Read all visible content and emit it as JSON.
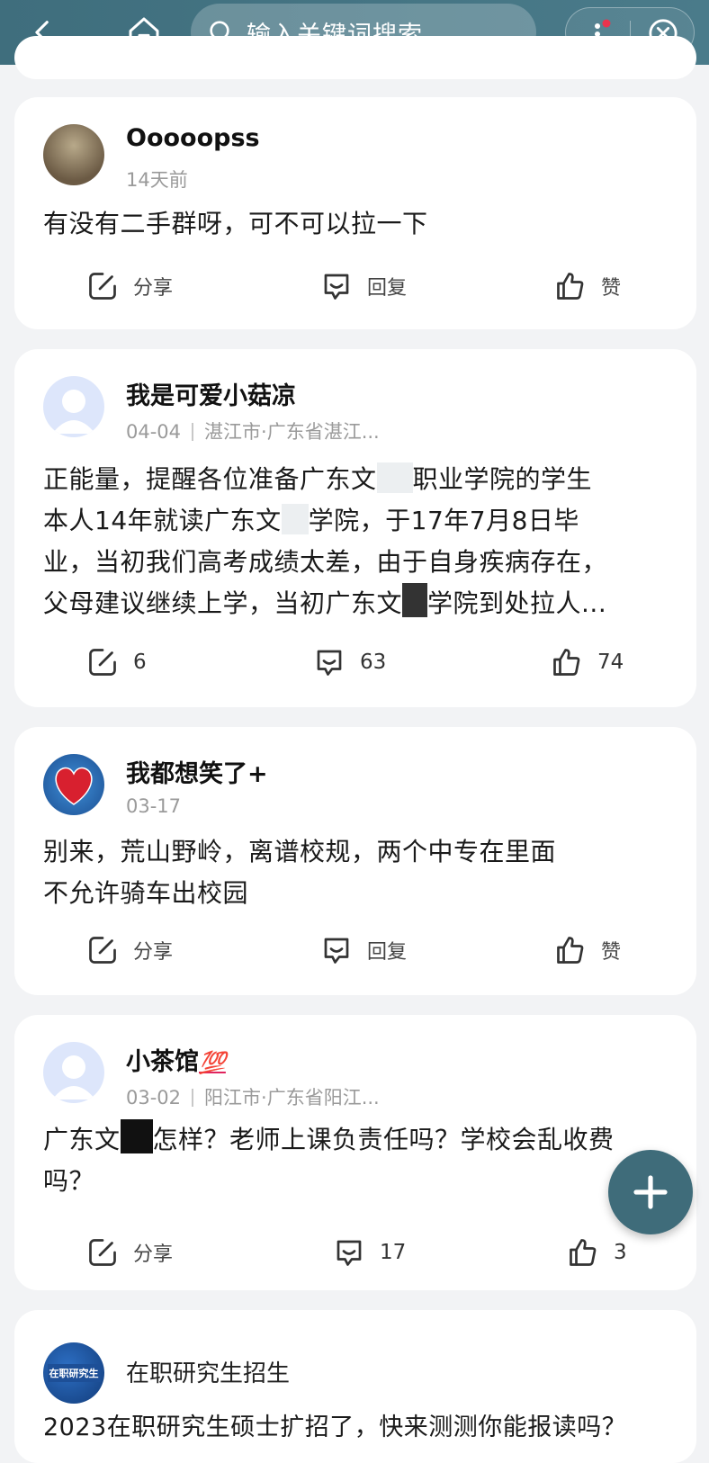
{
  "topbar": {
    "search_placeholder": "输入关键词搜索"
  },
  "posts": [
    {
      "username": "Ooooopss",
      "time": "14天前",
      "location": "",
      "content": "有没有二手群呀，可不可以拉一下",
      "share": "分享",
      "reply": "回复",
      "like": "赞"
    },
    {
      "username": "我是可爱小菇凉",
      "time": "04-04",
      "location": "湛江市·广东省湛江...",
      "content_lines": [
        "正能量，提醒各位准备广东文",
        "职业学院的学生",
        "本人14年就读广东文",
        "学院，于17年7月8日毕",
        "业，当初我们高考成绩太差，由于自身疾病存在，",
        "父母建议继续上学，当初广东文",
        "学院到处拉人..."
      ],
      "share": "6",
      "reply": "63",
      "like": "74"
    },
    {
      "username": "我都想笑了+",
      "time": "03-17",
      "location": "",
      "content_lines": [
        "别来，荒山野岭，离谱校规，两个中专在里面",
        "不允许骑车出校园"
      ],
      "share": "分享",
      "reply": "回复",
      "like": "赞"
    },
    {
      "username": "小茶馆",
      "username_emoji": "💯",
      "time": "03-02",
      "location": "阳江市·广东省阳江...",
      "content_lines": [
        "广东文",
        "怎样？老师上课负责任吗？学校会乱收费",
        "吗？"
      ],
      "share": "分享",
      "reply": "17",
      "like": "3"
    }
  ],
  "ad": {
    "title": "在职研究生招生",
    "logo_text": "在职研究生",
    "content": "2023在职研究生硕士扩招了，快来测测你能报读吗？"
  },
  "colors": {
    "topbar": "#436f7f",
    "fab": "#3f6c7a",
    "background": "#f2f3f5"
  }
}
